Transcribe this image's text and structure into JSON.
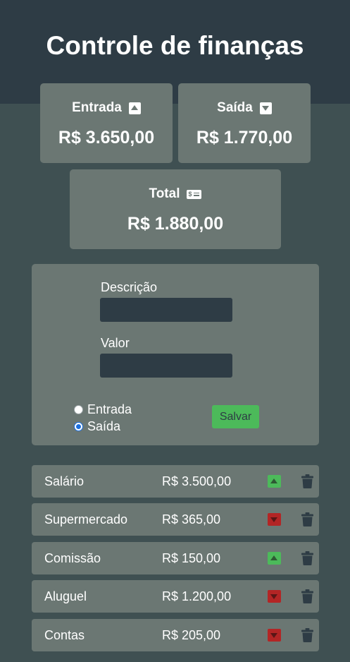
{
  "header": {
    "title": "Controle de finanças"
  },
  "summary": {
    "entrada": {
      "label": "Entrada",
      "value": "R$ 3.650,00",
      "icon": "arrow-up-square-icon"
    },
    "saida": {
      "label": "Saída",
      "value": "R$ 1.770,00",
      "icon": "arrow-down-square-icon"
    },
    "total": {
      "label": "Total",
      "value": "R$ 1.880,00",
      "icon": "money-bill-icon"
    }
  },
  "form": {
    "description_label": "Descrição",
    "description_value": "",
    "value_label": "Valor",
    "value_value": "",
    "radio_entrada_label": "Entrada",
    "radio_saida_label": "Saída",
    "selected_type": "Saída",
    "save_label": "Salvar"
  },
  "transactions": [
    {
      "description": "Salário",
      "amount": "R$ 3.500,00",
      "type": "entrada"
    },
    {
      "description": "Supermercado",
      "amount": "R$ 365,00",
      "type": "saida"
    },
    {
      "description": "Comissão",
      "amount": "R$ 150,00",
      "type": "entrada"
    },
    {
      "description": "Aluguel",
      "amount": "R$ 1.200,00",
      "type": "saida"
    },
    {
      "description": "Contas",
      "amount": "R$ 205,00",
      "type": "saida"
    }
  ],
  "colors": {
    "header_bg": "#2e3c45",
    "page_bg": "#3f5052",
    "card_bg": "#6b7773",
    "income": "#4cba5a",
    "expense": "#b32525",
    "save_button": "#4cba5a"
  }
}
